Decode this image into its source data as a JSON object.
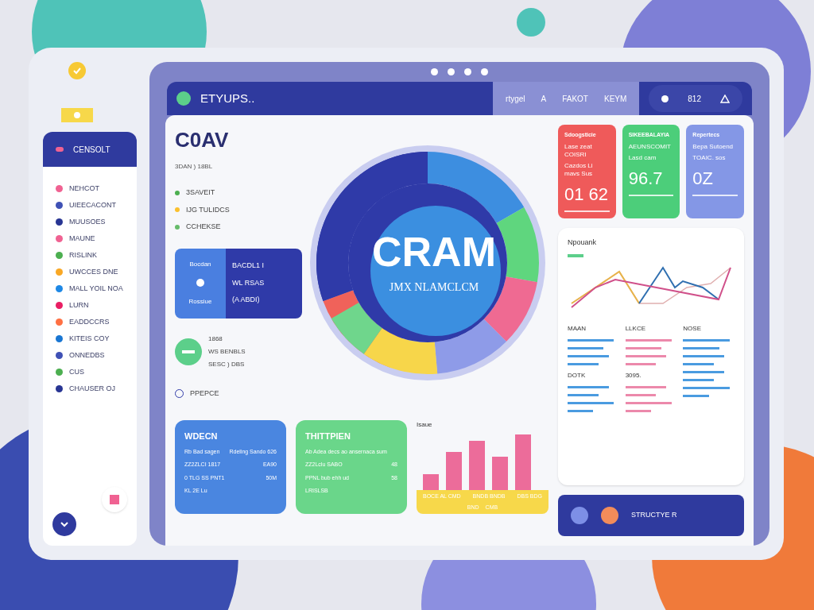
{
  "header": {
    "brand": "ETYUPS..",
    "nav": [
      {
        "label": "rtygel"
      },
      {
        "label": "A"
      },
      {
        "label": "FAKOT"
      },
      {
        "label": "KEYM"
      }
    ],
    "count": "812"
  },
  "sidebar": {
    "title": "CENSOLT",
    "items": [
      {
        "label": "NEHCOT",
        "color": "#f06292"
      },
      {
        "label": "UIEECACONT",
        "color": "#3f51b5"
      },
      {
        "label": "MUUSOES",
        "color": "#283593"
      },
      {
        "label": "MAUNE",
        "color": "#f06292"
      },
      {
        "label": "RISLINK",
        "color": "#4caf50"
      },
      {
        "label": "UWCCES DNE",
        "color": "#f9a825"
      },
      {
        "label": "MALL YOIL NOA",
        "color": "#1e88e5"
      },
      {
        "label": "LURN",
        "color": "#e91e63"
      },
      {
        "label": "EADDCCRS",
        "color": "#ff7043"
      },
      {
        "label": "KITEIS COY",
        "color": "#1976d2"
      },
      {
        "label": "ONNEDBS",
        "color": "#3f51b5"
      },
      {
        "label": "CUS",
        "color": "#4caf50"
      },
      {
        "label": "CHAUSER OJ",
        "color": "#283593"
      }
    ]
  },
  "overview": {
    "title": "C0AV",
    "subtitle": "3DAN ) 18BL",
    "legend": [
      {
        "label": "3SAVEIT",
        "color": "#4caf50"
      },
      {
        "label": "IJG TULIDCS",
        "color": "#fbc02d"
      },
      {
        "label": "CCHEKSE",
        "color": "#66bb6a"
      }
    ],
    "info_card": {
      "left": [
        "Bocdan",
        "Rossiue"
      ],
      "right": [
        "BACDL1 I",
        "WL RSAS",
        "(A ABDI)"
      ]
    },
    "status": [
      "1868",
      "WS BENBLS",
      "SESC ) DBS"
    ],
    "footer": "PPEPCE"
  },
  "donut": {
    "title": "CRAM",
    "subtitle": "JMX NLAMCLCM"
  },
  "stat_cards": [
    {
      "title": "Sdoogsticie",
      "sub": "Lase zeat COISRI",
      "note": "Cazdos Li mavs Sus",
      "value": "01 62",
      "color": "#ef5a5a"
    },
    {
      "title": "SIKEEBALAYIA",
      "sub": "AEUNSCOMIT",
      "note": "Lasd cam",
      "value": "96.7",
      "color": "#4cce7a"
    },
    {
      "title": "Repertecs",
      "sub": "Bepa Sutoend",
      "note": "TOAIC. sos",
      "value": "0Z",
      "color": "#8497e6"
    }
  ],
  "trend_card": {
    "title": "Npouank",
    "columns": [
      {
        "title": "MAAN",
        "color": "#4a9be0",
        "footer": "DOTK"
      },
      {
        "title": "LLKCE",
        "color": "#ec89ab",
        "footer": "3095."
      },
      {
        "title": "NOSE",
        "color": "#4a9be0"
      }
    ]
  },
  "bottom_cards": [
    {
      "title": "WDECN",
      "color": "#4a86e0",
      "rows": [
        [
          "Rb Bad sagen",
          "Rdeling Sando 626"
        ],
        [
          "ZZ2ZLCI 1817",
          "EA90"
        ],
        [
          "0 TLG SS PNT1",
          "50M"
        ],
        [
          "KL 2E Lu"
        ]
      ]
    },
    {
      "title": "THITTPIEN",
      "color": "#6ad68a",
      "rows": [
        [
          "Ab Adea decs ao ansernaca sum"
        ],
        [
          "ZZ2Lclu SABO",
          "48"
        ],
        [
          "PPNL bub ehh ud",
          "58"
        ],
        [
          "LRISLSB"
        ]
      ]
    }
  ],
  "bar_card": {
    "title": "Isaue",
    "footer": [
      "BOCE AL CMD",
      "BNDB BNDB",
      "DBS BDG"
    ],
    "tags": [
      "BND",
      "CMB"
    ]
  },
  "bottom_bar": {
    "title": "STRUCTYE R",
    "dots": [
      {
        "color": "#7d8fe6"
      },
      {
        "color": "#f28c5a"
      }
    ]
  }
}
